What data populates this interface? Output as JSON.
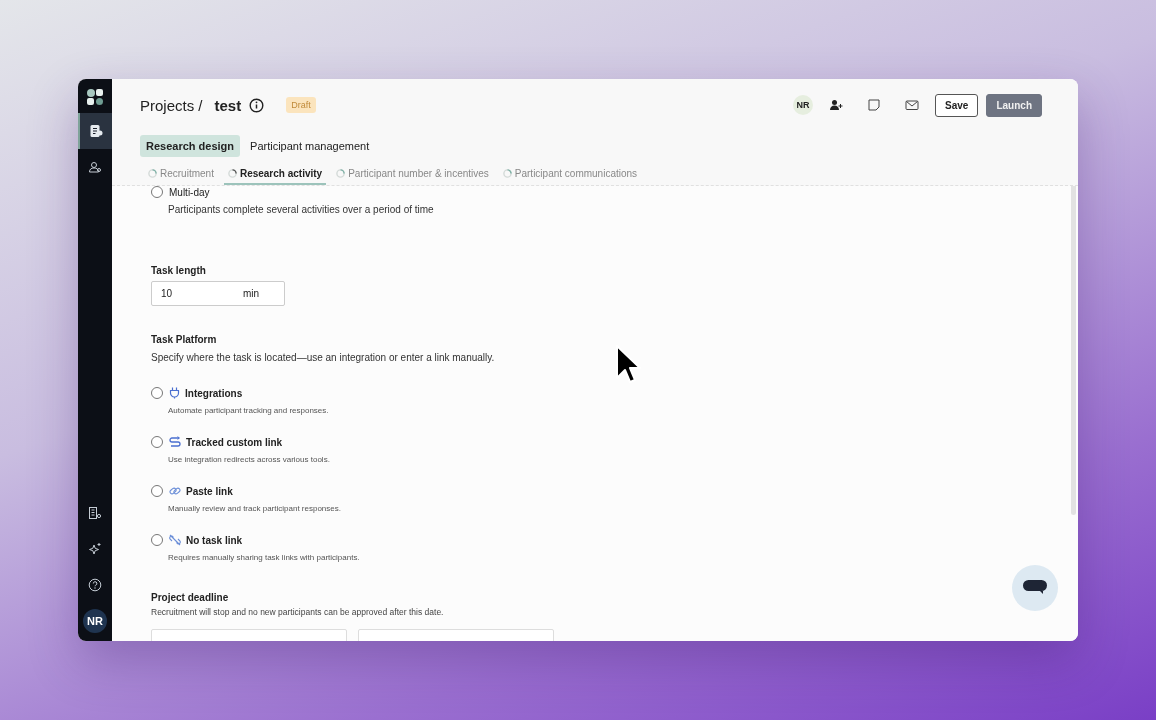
{
  "sidebar": {
    "nav": [
      {
        "kind": "document",
        "selected": true
      },
      {
        "kind": "people",
        "selected": false
      }
    ],
    "bottom": [
      {
        "kind": "building"
      },
      {
        "kind": "sparkle"
      },
      {
        "kind": "help"
      }
    ],
    "avatar": "NR"
  },
  "header": {
    "breadcrumb": "Projects /",
    "title": "test",
    "status": "Draft",
    "avatar": "NR",
    "buttons": [
      {
        "kind": "secondary",
        "label": "Save"
      },
      {
        "kind": "primary",
        "label": "Launch"
      }
    ]
  },
  "tabs": [
    {
      "label": "Research design",
      "selected": true
    },
    {
      "label": "Participant management",
      "selected": false
    }
  ],
  "steps": [
    {
      "label": "Recruitment",
      "selected": false
    },
    {
      "label": "Research activity",
      "selected": true
    },
    {
      "label": "Participant number & incentives",
      "selected": false
    },
    {
      "label": "Participant communications",
      "selected": false
    }
  ],
  "duration_option": {
    "label": "Multi-day",
    "description": "Participants complete several activities over a period of time",
    "selected": false
  },
  "task_length": {
    "label": "Task length",
    "value": "10",
    "unit": "min"
  },
  "task_platform": {
    "title": "Task Platform",
    "description": "Specify where the task is located—use an integration or enter a link manually.",
    "options": [
      {
        "kind": "plug",
        "label": "Integrations",
        "description": "Automate participant tracking and responses.",
        "selected": false
      },
      {
        "kind": "redirect",
        "label": "Tracked custom link",
        "description": "Use integration redirects across various tools.",
        "selected": false
      },
      {
        "kind": "link",
        "label": "Paste link",
        "description": "Manually review and track participant responses.",
        "selected": false
      },
      {
        "kind": "nolink",
        "label": "No task link",
        "description": "Requires manually sharing task links with participants.",
        "selected": false
      }
    ]
  },
  "deadline": {
    "title": "Project deadline",
    "description": "Recruitment will stop and no new participants can be approved after this date."
  }
}
